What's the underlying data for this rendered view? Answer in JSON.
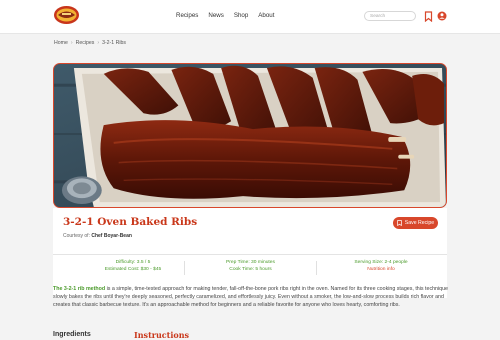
{
  "header": {
    "nav": [
      "Recipes",
      "News",
      "Shop",
      "About"
    ],
    "search_placeholder": "Search"
  },
  "breadcrumb": [
    "Home",
    "Recipes",
    "3-2-1 Ribs"
  ],
  "recipe": {
    "title": "3-2-1 Oven Baked Ribs",
    "courtesy_prefix": "Courtesy of:",
    "author": "Chef Boyar-Bean",
    "save_label": "Save Recipe"
  },
  "stats": {
    "difficulty": "Difficulty: 3.5 / 5",
    "cost": "Estimated Cost: $30 - $45",
    "prep_time": "Prep Time: 30 minutes",
    "cook_time": "Cook Time: 5 hours",
    "serving_size": "Serving Size: 2-4 people",
    "nutrition": "Nutrition info"
  },
  "description": {
    "lead": "The 3-2-1 rib method",
    "body": " is a simple, time-tested approach for making tender, fall-off-the-bone pork ribs right in the oven. Named for its three cooking stages, this technique slowly bakes the ribs until they're deeply seasoned, perfectly caramelized, and effortlessly juicy. Even without a smoker, the low-and-slow process builds rich flavor and creates that classic barbecue texture. It's an approachable method for beginners and a reliable favorite for anyone who loves hearty, comforting ribs."
  },
  "sections": {
    "ingredients": "Ingredients",
    "instructions": "Instructions"
  },
  "colors": {
    "accent": "#d8472b",
    "green": "#4a9a2a"
  },
  "icons": [
    "logo",
    "search-icon",
    "bookmark-icon",
    "user-icon",
    "save-icon"
  ]
}
